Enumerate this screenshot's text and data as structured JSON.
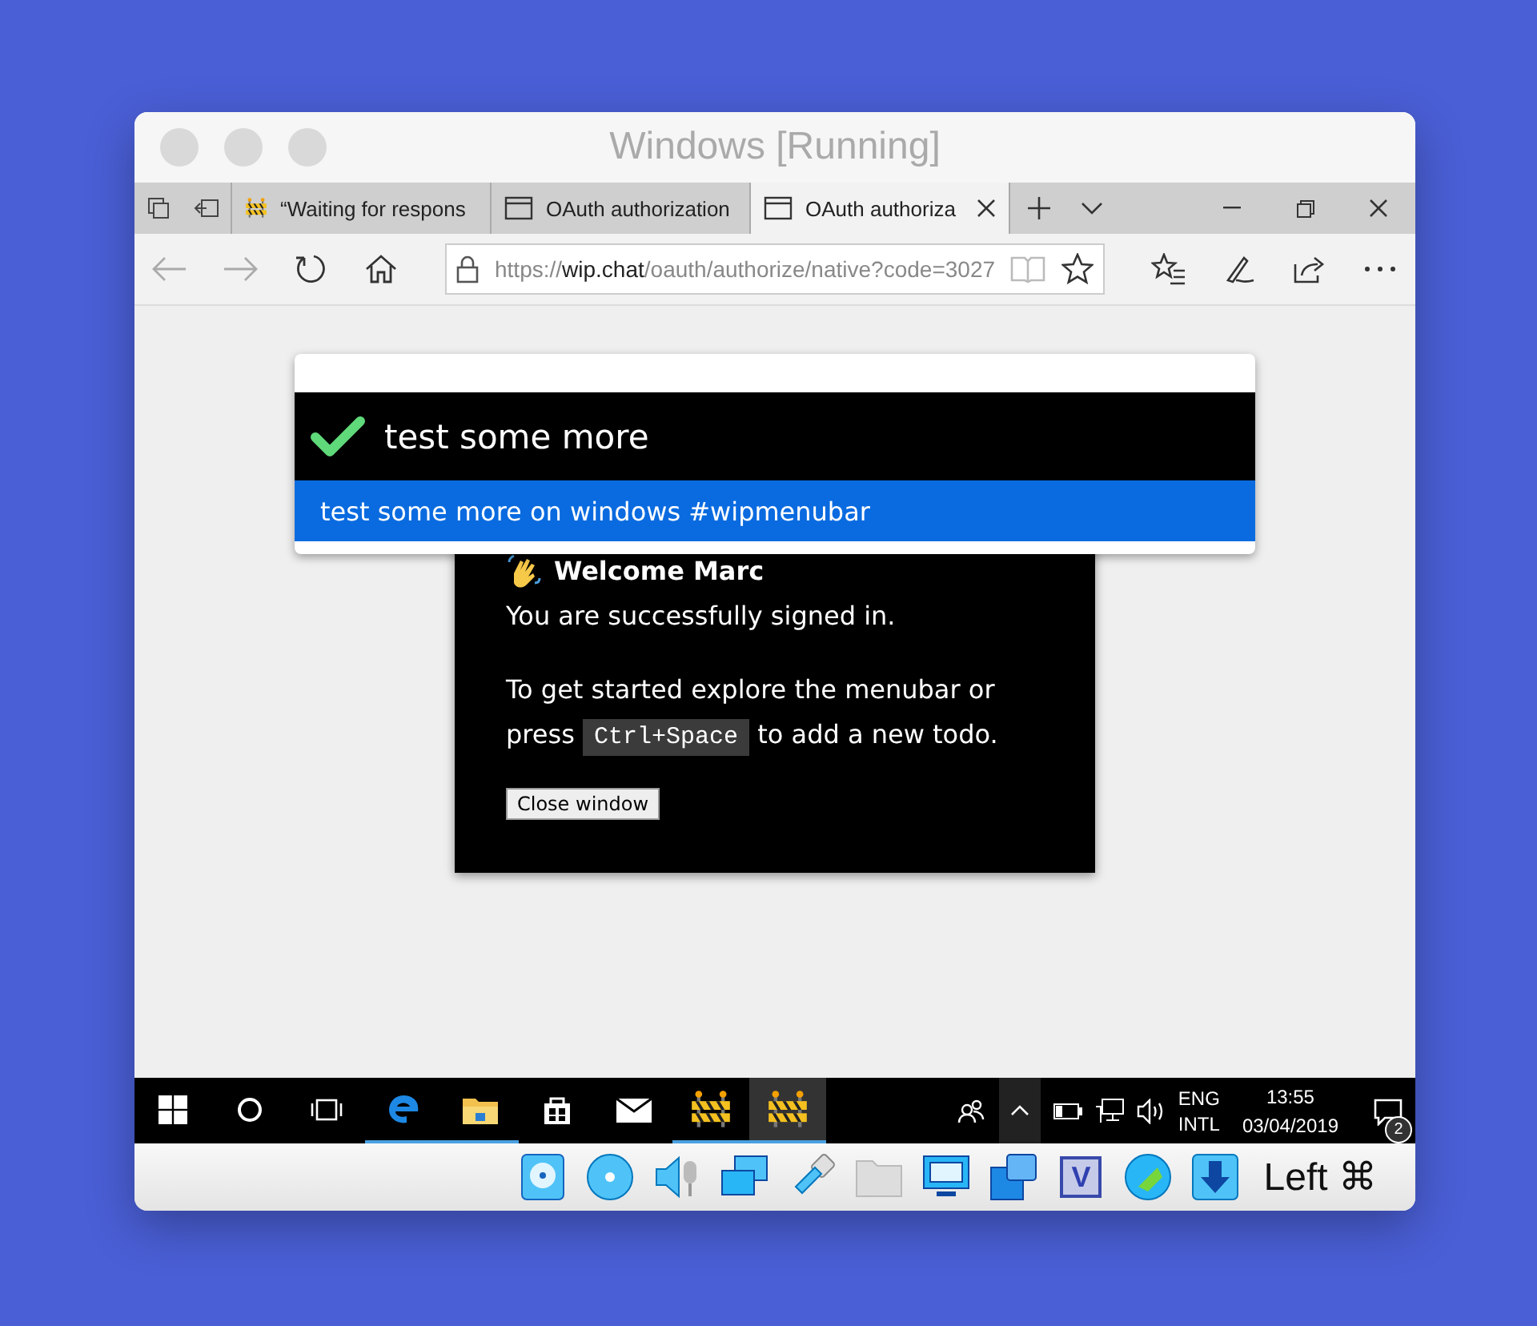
{
  "window": {
    "title": "Windows [Running]"
  },
  "browser": {
    "tabs": [
      {
        "kind": "barrier",
        "label": "“Waiting for respons",
        "selected": false
      },
      {
        "kind": "page",
        "label": "OAuth authorization",
        "selected": false
      },
      {
        "kind": "page",
        "label": "OAuth authoriza",
        "selected": true
      }
    ],
    "address": {
      "scheme": "https://",
      "host": "wip.chat",
      "path": "/oauth/authorize/native?code=3027"
    }
  },
  "popup": {
    "title": "test some more",
    "suggestions": [
      {
        "text": "test some more on windows #wipmenubar",
        "selected": true
      }
    ]
  },
  "dialog": {
    "heading": "Welcome Marc",
    "status": "You are successfully signed in.",
    "instructions": {
      "before": "To get started explore the menubar or press",
      "key": "Ctrl+Space",
      "after": "to add a new todo."
    },
    "button": "Close window"
  },
  "taskbar": {
    "apps": [
      {
        "kind": "edge",
        "running": true,
        "selected": false
      },
      {
        "kind": "folder",
        "running": true,
        "selected": false
      },
      {
        "kind": "store",
        "running": false,
        "selected": false
      },
      {
        "kind": "mail",
        "running": false,
        "selected": false
      },
      {
        "kind": "barrier",
        "running": true,
        "selected": false
      },
      {
        "kind": "barrier",
        "running": true,
        "selected": true
      }
    ],
    "language": "ENG",
    "layout": "INTL",
    "time": "13:55",
    "date": "03/04/2019",
    "notifications": "2"
  },
  "vm_status": {
    "devices": [
      {
        "kind": "disk"
      },
      {
        "kind": "optical"
      },
      {
        "kind": "audio"
      },
      {
        "kind": "network"
      },
      {
        "kind": "usb"
      },
      {
        "kind": "shared"
      },
      {
        "kind": "display"
      },
      {
        "kind": "capture"
      },
      {
        "kind": "cpu",
        "label": "V"
      },
      {
        "kind": "mouse"
      },
      {
        "kind": "download"
      }
    ],
    "host_key": "Left ⌘"
  }
}
